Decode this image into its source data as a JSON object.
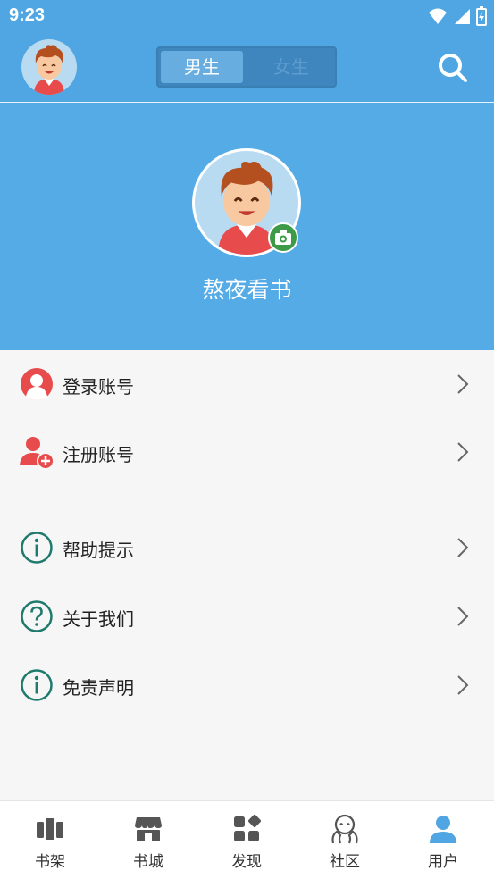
{
  "status_bar": {
    "time": "9:23"
  },
  "header": {
    "gender_tabs": [
      {
        "label": "男生",
        "selected": true
      },
      {
        "label": "女生",
        "selected": false
      }
    ]
  },
  "profile": {
    "username": "熬夜看书"
  },
  "menu": {
    "group1": [
      {
        "label": "登录账号",
        "icon": "user-icon"
      },
      {
        "label": "注册账号",
        "icon": "add-user-icon"
      }
    ],
    "group2": [
      {
        "label": "帮助提示",
        "icon": "info-icon"
      },
      {
        "label": "关于我们",
        "icon": "question-icon"
      },
      {
        "label": "免责声明",
        "icon": "info-icon"
      }
    ]
  },
  "bottom_nav": [
    {
      "label": "书架",
      "icon": "bookshelf-icon"
    },
    {
      "label": "书城",
      "icon": "store-icon"
    },
    {
      "label": "发现",
      "icon": "discover-icon"
    },
    {
      "label": "社区",
      "icon": "community-icon"
    },
    {
      "label": "用户",
      "icon": "user-icon",
      "active": true
    }
  ],
  "colors": {
    "primary": "#4fa6e2",
    "accent_red": "#e84b4b",
    "icon_teal": "#1f7a6e",
    "active_nav": "#4fa6e2"
  }
}
